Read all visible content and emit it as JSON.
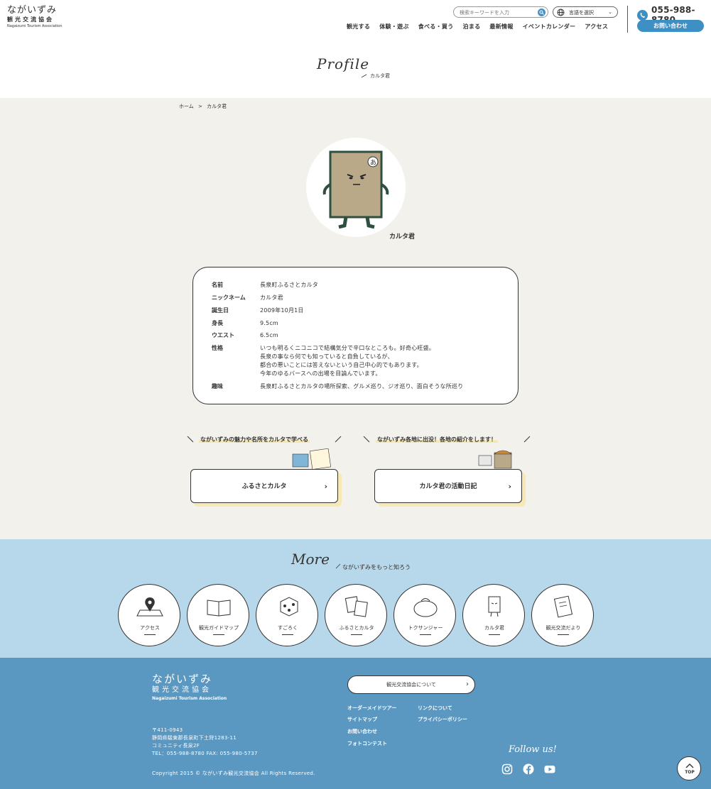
{
  "header": {
    "logo_main": "ながいずみ",
    "logo_sub": "観光交流協会",
    "logo_en": "Nagaizumi Tourism Association",
    "search_placeholder": "検索キーワードを入力",
    "lang_label": "言語を選択",
    "nav": [
      "観光する",
      "体験・遊ぶ",
      "食べる・買う",
      "泊まる",
      "最新情報",
      "イベントカレンダー",
      "アクセス"
    ],
    "phone": "055-988-8780",
    "contact": "お問い合わせ"
  },
  "title": {
    "en": "Profile",
    "jp": "カルタ君"
  },
  "breadcrumb": {
    "home": "ホーム",
    "sep": ">",
    "current": "カルタ君"
  },
  "character": {
    "name": "カルタ君",
    "card_letter": "あ"
  },
  "profile": [
    {
      "key": "名前",
      "value": "長泉町ふるさとカルタ"
    },
    {
      "key": "ニックネーム",
      "value": "カルタ君"
    },
    {
      "key": "誕生日",
      "value": "2009年10月1日"
    },
    {
      "key": "身長",
      "value": "9.5cm"
    },
    {
      "key": "ウエスト",
      "value": "6.5cm"
    },
    {
      "key": "性格",
      "value": [
        "いつも明るくニコニコで結構気分で辛口なところも。好奇心旺盛。",
        "長泉の事なら何でも知っていると自負しているが、",
        "都合の悪いことには答えないという自己中心的でもあります。",
        "今年のゆるバースへの出場を目論んでいます。"
      ]
    },
    {
      "key": "趣味",
      "value": "長泉町ふるさとカルタの場所探索、グルメ巡り、ジオ巡り、面白そうな所巡り"
    }
  ],
  "links": [
    {
      "caption": "ながいずみの魅力や名所をカルタで学べる",
      "label": "ふるさとカルタ"
    },
    {
      "caption": "ながいずみ各地に出没！各地の紹介をします！",
      "label": "カルタ君の活動日記"
    }
  ],
  "more": {
    "en": "More",
    "jp": "ながいずみをもっと知ろう",
    "items": [
      {
        "label": "アクセス",
        "icon": "map-pin-icon"
      },
      {
        "label": "観光ガイドマップ",
        "icon": "book-icon"
      },
      {
        "label": "すごろく",
        "icon": "dice-icon"
      },
      {
        "label": "ふるさとカルタ",
        "icon": "cards-icon"
      },
      {
        "label": "トクサンジャー",
        "icon": "character-icon"
      },
      {
        "label": "カルタ君",
        "icon": "karuta-kun-icon"
      },
      {
        "label": "観光交流だより",
        "icon": "newsletter-icon"
      }
    ]
  },
  "footer": {
    "logo_main": "ながいずみ",
    "logo_sub": "観光交流協会",
    "logo_en": "Nagaizumi Tourism Association",
    "address": [
      "〒411-0943",
      "静岡県駿東郡長泉町下土狩1283-11",
      "コミュニティ長泉2F",
      "TEL：055-988-8780 FAX: 055-980-5737"
    ],
    "copyright": "Copyright 2015 © ながいずみ観光交流協会 All Rights Reserved.",
    "about": "観光交流協会について",
    "links": [
      "オーダーメイドツアー",
      "リンクについて",
      "サイトマップ",
      "プライバシーポリシー",
      "お問い合わせ",
      "フォトコンテスト"
    ],
    "follow": "Follow us!",
    "top": "TOP"
  },
  "colors": {
    "accent": "#3e8fc4",
    "more_bg": "#b7d8ea",
    "footer_bg": "#5a97c1",
    "main_bg": "#f2f1ec",
    "highlight": "#f7e7a8"
  }
}
